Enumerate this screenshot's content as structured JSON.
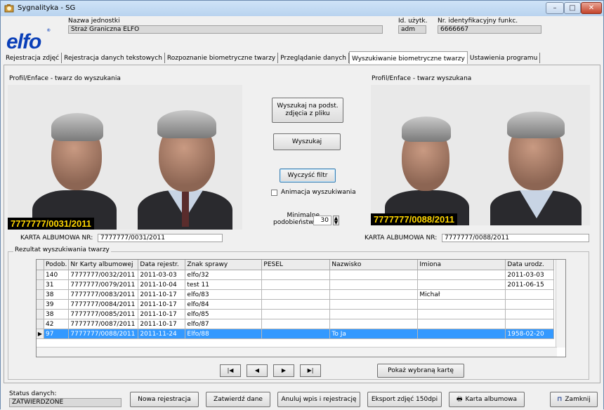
{
  "window": {
    "title": "Sygnalityka - SG",
    "minimize": "–",
    "maximize": "□",
    "close": "✕"
  },
  "header": {
    "logo": "elfo",
    "logo_mark": "®",
    "unit_label": "Nazwa jednostki",
    "unit_value": "Straż Graniczna ELFO",
    "user_id_label": "Id. użytk.",
    "user_id_value": "adm",
    "func_id_label": "Nr. identyfikacyjny funkc.",
    "func_id_value": "6666667"
  },
  "tabs": [
    {
      "label": "Rejestracja zdjęć"
    },
    {
      "label": "Rejestracja danych tekstowych"
    },
    {
      "label": "Rozpoznanie biometryczne twarzy"
    },
    {
      "label": "Przeglądanie danych"
    },
    {
      "label": "Wyszukiwanie biometryczne twarzy",
      "active": true
    },
    {
      "label": "Ustawienia programu"
    }
  ],
  "left": {
    "title": "Profil/Enface - twarz  do wyszukania",
    "photo_id": "7777777/0031/2011",
    "card_label": "KARTA ALBUMOWA NR:",
    "card_value": "7777777/0031/2011"
  },
  "right": {
    "title": "Profil/Enface - twarz wyszukana",
    "photo_id": "7777777/0088/2011",
    "card_label": "KARTA ALBUMOWA NR:",
    "card_value": "7777777/0088/2011"
  },
  "middle": {
    "search_file_btn": "Wyszukaj na podst.\nzdjęcia z pliku",
    "search_btn": "Wyszukaj",
    "clear_btn": "Wyczyść filtr",
    "animation_label": "Animacja wyszukiwania",
    "min_sim_label": "Minimalne\npodobieństwo:",
    "min_sim_value": "30"
  },
  "results": {
    "title": "Rezultat wyszukiwania twarzy",
    "columns": [
      "Podob.",
      "Nr Karty albumowej",
      "Data rejestr.",
      "Znak sprawy",
      "PESEL",
      "Nazwisko",
      "Imiona",
      "Data urodz."
    ],
    "rows": [
      [
        "140",
        "7777777/0032/2011",
        "2011-03-03",
        "elfo/32",
        "",
        "",
        "",
        "2011-03-03"
      ],
      [
        "31",
        "7777777/0079/2011",
        "2011-10-04",
        "test 11",
        "",
        "",
        "",
        "2011-06-15"
      ],
      [
        "38",
        "7777777/0083/2011",
        "2011-10-17",
        "elfo/83",
        "",
        "",
        "Michał",
        ""
      ],
      [
        "39",
        "7777777/0084/2011",
        "2011-10-17",
        "elfo/84",
        "",
        "",
        "",
        ""
      ],
      [
        "38",
        "7777777/0085/2011",
        "2011-10-17",
        "elfo/85",
        "",
        "",
        "",
        ""
      ],
      [
        "42",
        "7777777/0087/2011",
        "2011-10-17",
        "elfo/87",
        "",
        "",
        "",
        ""
      ],
      [
        "97",
        "7777777/0088/2011",
        "2011-11-24",
        "Elfo/88",
        "",
        "To Ja",
        "",
        "1958-02-20"
      ]
    ],
    "selected_row": 6,
    "show_card_btn": "Pokaż wybraną kartę",
    "nav": [
      "|◀",
      "◀",
      "▶",
      "▶|"
    ]
  },
  "bottom": {
    "status_label": "Status danych:",
    "status_value": "ZATWIERDZONE",
    "new_reg": "Nowa rejestracja",
    "approve": "Zatwierdź dane",
    "cancel": "Anuluj wpis i rejestrację",
    "export": "Eksport zdjęć 150dpi",
    "album": "Karta albumowa",
    "close": "Zamknij"
  },
  "colors": {
    "selection": "#3399ff",
    "logo": "#0a3fb8",
    "photo_label": "#ffd600"
  }
}
